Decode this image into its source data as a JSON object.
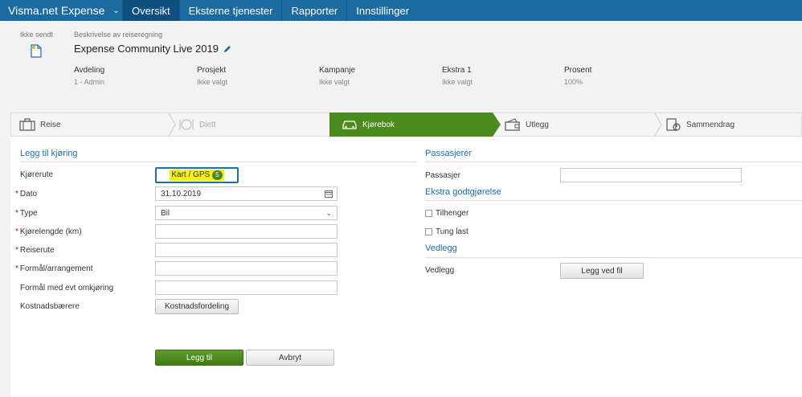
{
  "nav": {
    "brand": "Visma.net Expense",
    "tabs": [
      {
        "label": "Oversikt",
        "active": true
      },
      {
        "label": "Eksterne tjenester",
        "active": false
      },
      {
        "label": "Rapporter",
        "active": false
      },
      {
        "label": "Innstillinger",
        "active": false
      }
    ]
  },
  "header": {
    "status": "Ikke sendt",
    "description_label": "Beskrivelse av reiseregning",
    "description_value": "Expense Community Live 2019",
    "fields": [
      {
        "label": "Avdeling",
        "value": "1 - Admin"
      },
      {
        "label": "Prosjekt",
        "value": "Ikke valgt"
      },
      {
        "label": "Kampanje",
        "value": "Ikke valgt"
      },
      {
        "label": "Ekstra 1",
        "value": "Ikke valgt"
      },
      {
        "label": "Prosent",
        "value": "100%"
      }
    ]
  },
  "steps": [
    {
      "label": "Reise",
      "icon": "suitcase-icon",
      "state": "normal"
    },
    {
      "label": "Diett",
      "icon": "plate-icon",
      "state": "disabled"
    },
    {
      "label": "Kjørebok",
      "icon": "car-icon",
      "state": "active"
    },
    {
      "label": "Utlegg",
      "icon": "wallet-icon",
      "state": "normal"
    },
    {
      "label": "Sammendrag",
      "icon": "summary-icon",
      "state": "normal"
    }
  ],
  "left_form": {
    "title": "Legg til kjøring",
    "route_label": "Kjørerute",
    "gps_button": "Kart / GPS",
    "gps_badge": "5",
    "date_label": "Dato",
    "date_value": "31.10.2019",
    "type_label": "Type",
    "type_value": "Bil",
    "distance_label": "Kjørelengde (km)",
    "distance_value": "",
    "trip_route_label": "Reiserute",
    "trip_route_value": "",
    "purpose_label": "Formål/arrangement",
    "purpose_value": "",
    "detour_label": "Formål med evt omkjøring",
    "detour_value": "",
    "cost_carrier_label": "Kostnadsbærere",
    "cost_button": "Kostnadsfordeling",
    "add_button": "Legg til",
    "cancel_button": "Avbryt"
  },
  "right_form": {
    "passengers_title": "Passasjerer",
    "passenger_label": "Passasjer",
    "passenger_value": "",
    "extra_title": "Ekstra godtgjørelse",
    "trailer_label": "Tilhenger",
    "heavy_label": "Tung last",
    "attachments_title": "Vedlegg",
    "attachment_label": "Vedlegg",
    "attach_button": "Legg ved fil"
  },
  "colors": {
    "nav": "#1b6aa0",
    "nav_active": "#0f4f80",
    "accent_green": "#4b8a1c",
    "link_blue": "#1f6ea8",
    "required_red": "#cc0000",
    "highlight": "#f5f018"
  }
}
